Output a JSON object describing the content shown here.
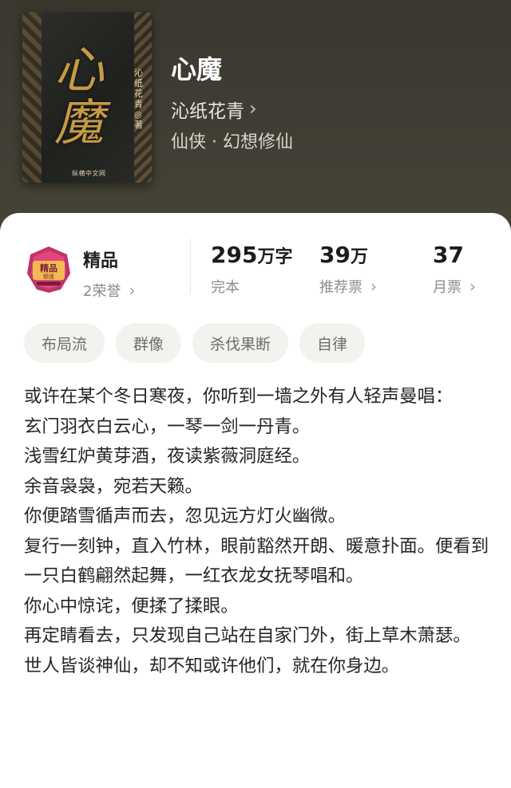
{
  "book": {
    "title": "心魔",
    "author": "沁纸花青",
    "genre": "仙侠 · 幻想修仙",
    "cover_title": "心魔",
    "cover_author": "沁纸花青◎著",
    "cover_publisher": "纵横中文网"
  },
  "honor": {
    "badge_text": "精品",
    "label": "精品",
    "sub": "2荣誉"
  },
  "stats": {
    "words_value": "295",
    "words_unit": "万字",
    "words_caption": "完本",
    "recommend_value": "39",
    "recommend_unit": "万",
    "recommend_caption": "推荐票",
    "monthly_value": "37",
    "monthly_caption": "月票"
  },
  "tags": [
    "布局流",
    "群像",
    "杀伐果断",
    "自律"
  ],
  "synopsis": [
    "或许在某个冬日寒夜，你听到一墙之外有人轻声曼唱：",
    "玄门羽衣白云心，一琴一剑一丹青。",
    "浅雪红炉黄芽酒，夜读紫薇洞庭经。",
    "余音袅袅，宛若天籁。",
    "你便踏雪循声而去，忽见远方灯火幽微。",
    "复行一刻钟，直入竹林，眼前豁然开朗、暖意扑面。便看到一只白鹤翩然起舞，一红衣龙女抚琴唱和。",
    "你心中惊诧，便揉了揉眼。",
    "再定睛看去，只发现自己站在自家门外，街上草木萧瑟。",
    "世人皆谈神仙，却不知或许他们，就在你身边。"
  ],
  "colors": {
    "header_bg": "#3f3c33",
    "cover_title": "#c79a45",
    "badge_primary": "#c0336a",
    "badge_gold": "#f2c14e"
  }
}
